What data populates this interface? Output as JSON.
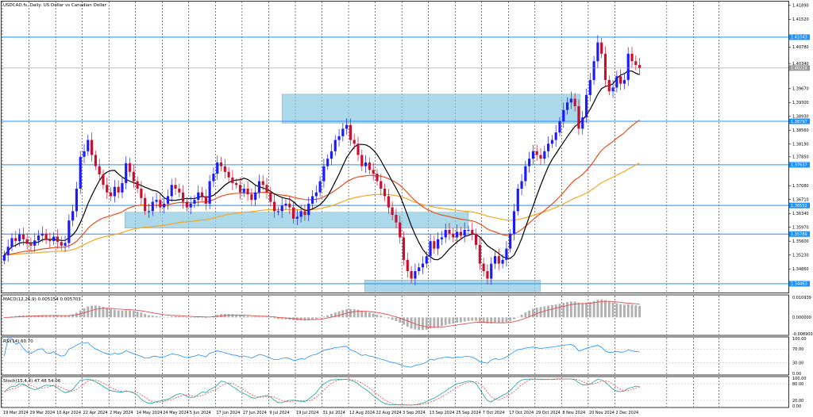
{
  "chart_data": {
    "type": "candlestick",
    "symbol_title": "USDCAD.fs, Daily:  US Dollar vs Canadian Dollar",
    "current_price": "1.40224",
    "y_ticks": [
      "1.41890",
      "1.41520",
      "1.40780",
      "1.40340",
      "1.39670",
      "1.39300",
      "1.38930",
      "1.38560",
      "1.38190",
      "1.37850",
      "1.37080",
      "1.36710",
      "1.36340",
      "1.35970",
      "1.35600",
      "1.35230",
      "1.34860"
    ],
    "y_tick_values": [
      1.4189,
      1.4152,
      1.4078,
      1.4034,
      1.3967,
      1.393,
      1.3893,
      1.3856,
      1.3819,
      1.3785,
      1.3708,
      1.3671,
      1.3634,
      1.3597,
      1.356,
      1.3523,
      1.3486
    ],
    "x_ticks": [
      "19 Mar 2024",
      "29 Mar 2024",
      "10 Apr 2024",
      "22 Apr 2024",
      "2 May 2024",
      "14 May 2024",
      "24 May 2024",
      "5 Jun 2024",
      "17 Jun 2024",
      "27 Jun 2024",
      "9 Jul 2024",
      "19 Jul 2024",
      "31 Jul 2024",
      "12 Aug 2024",
      "22 Aug 2024",
      "3 Sep 2024",
      "13 Sep 2024",
      "25 Sep 2024",
      "7 Oct 2024",
      "17 Oct 2024",
      "29 Oct 2024",
      "8 Nov 2024",
      "20 Nov 2024",
      "2 Dec 2024"
    ],
    "levels": [
      {
        "label": "1.41043",
        "value": 1.41043
      },
      {
        "label": "1.38797",
        "value": 1.38797
      },
      {
        "label": "1.37637",
        "value": 1.37637
      },
      {
        "label": "1.36552",
        "value": 1.36552
      },
      {
        "label": "1.35789",
        "value": 1.35789
      },
      {
        "label": "1.34463",
        "value": 1.34463
      }
    ],
    "zones": [
      {
        "x_from": "31 Jul 2024",
        "x_from_offset": -1.5,
        "x_to": "20 Nov 2024",
        "x_to_offset": -0.3,
        "y_low": 1.3875,
        "y_high": 1.3952
      },
      {
        "x_from": "14 May 2024",
        "x_from_offset": -0.4,
        "x_to": "17 Oct 2024",
        "x_to_offset": -1.5,
        "y_low": 1.3595,
        "y_high": 1.3637
      },
      {
        "x_from": "22 Aug 2024",
        "x_from_offset": -0.4,
        "x_to": "29 Oct 2024",
        "x_to_offset": 0.2,
        "y_low": 1.3425,
        "y_high": 1.3456
      }
    ],
    "closes": [
      1.3523,
      1.3545,
      1.3568,
      1.356,
      1.3578,
      1.3565,
      1.3553,
      1.3548,
      1.3562,
      1.3575,
      1.358,
      1.3563,
      1.356,
      1.3572,
      1.3558,
      1.3548,
      1.3555,
      1.3615,
      1.364,
      1.37,
      1.3785,
      1.38,
      1.383,
      1.379,
      1.376,
      1.3738,
      1.371,
      1.369,
      1.368,
      1.3705,
      1.369,
      1.3715,
      1.3768,
      1.3745,
      1.372,
      1.37,
      1.3675,
      1.364,
      1.364,
      1.3665,
      1.367,
      1.365,
      1.366,
      1.368,
      1.371,
      1.37,
      1.369,
      1.3665,
      1.365,
      1.366,
      1.367,
      1.369,
      1.368,
      1.366,
      1.372,
      1.374,
      1.377,
      1.376,
      1.3745,
      1.373,
      1.3715,
      1.371,
      1.369,
      1.37,
      1.3685,
      1.367,
      1.369,
      1.372,
      1.371,
      1.369,
      1.3665,
      1.364,
      1.364,
      1.3655,
      1.366,
      1.365,
      1.362,
      1.3625,
      1.364,
      1.363,
      1.366,
      1.368,
      1.369,
      1.372,
      1.376,
      1.378,
      1.38,
      1.383,
      1.384,
      1.386,
      1.387,
      1.383,
      1.382,
      1.379,
      1.376,
      1.377,
      1.375,
      1.374,
      1.372,
      1.37,
      1.368,
      1.365,
      1.363,
      1.361,
      1.357,
      1.351,
      1.348,
      1.346,
      1.348,
      1.349,
      1.35,
      1.352,
      1.356,
      1.354,
      1.3565,
      1.357,
      1.359,
      1.358,
      1.357,
      1.3585,
      1.3575,
      1.359,
      1.359,
      1.358,
      1.355,
      1.35,
      1.348,
      1.346,
      1.35,
      1.352,
      1.35,
      1.351,
      1.354,
      1.358,
      1.364,
      1.37,
      1.372,
      1.376,
      1.378,
      1.38,
      1.379,
      1.378,
      1.38,
      1.382,
      1.383,
      1.385,
      1.388,
      1.391,
      1.393,
      1.394,
      1.392,
      1.386,
      1.389,
      1.395,
      1.399,
      1.404,
      1.409,
      1.406,
      1.399,
      1.396,
      1.397,
      1.4,
      1.398,
      1.399,
      1.406,
      1.404,
      1.403,
      1.4022
    ],
    "macd_label": "MACD(12,26,9) 0.005154 0.005703",
    "macd_ticks": [
      "0.010939",
      "0.000000",
      "-0.008900"
    ],
    "macd_tick_values": [
      0.010939,
      0.0,
      -0.0089
    ],
    "rsi_label": "RSI(14) 60.70",
    "rsi_ticks": [
      "100.00",
      "70.00",
      "30.00",
      "0.00"
    ],
    "rsi_tick_values": [
      100,
      70,
      30,
      0
    ],
    "stoch_label": "Stoch(15,4,4) 47.48 54.06",
    "stoch_ticks": [
      "100.00",
      "80.00",
      "20.00",
      "0.00"
    ],
    "stoch_tick_values": [
      100,
      80,
      20,
      0
    ],
    "colors": {
      "bull": "#1a1aff",
      "bear": "#c8102e",
      "level": "#1e90ff",
      "zone": "#8ccbe0",
      "ma_fast": "#000000",
      "ma_mid": "#e8501c",
      "ma_slow": "#f5a623",
      "macd_hist": "#b0b0b0",
      "macd_signal": "#e05050",
      "rsi": "#1e90ff",
      "stoch_main": "#1aa39a",
      "stoch_signal": "#e05050",
      "grid": "#000000"
    }
  }
}
